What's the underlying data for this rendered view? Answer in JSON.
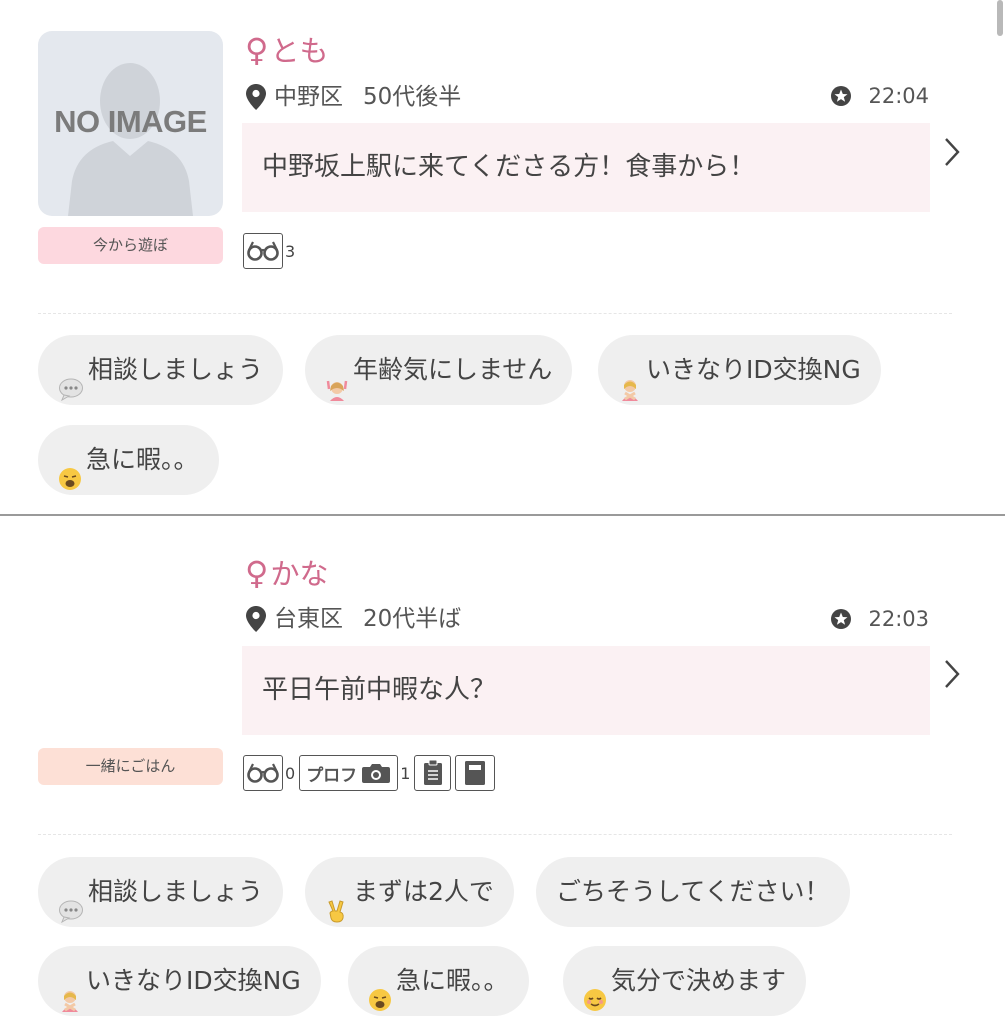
{
  "posts": [
    {
      "name": "とも",
      "area": "中野区",
      "age": "50代後半",
      "time": "22:04",
      "message": "中野坂上駅に来てくださる方！食事から！",
      "avatar_text": "NO IMAGE",
      "tag": "今から遊ぼ",
      "views": "3",
      "chips": [
        {
          "icon": "speech-bubble-icon",
          "label": "相談しましょう"
        },
        {
          "icon": "person-ok-icon",
          "label": "年齢気にしません"
        },
        {
          "icon": "person-no-icon",
          "label": "いきなりID交換NG"
        },
        {
          "icon": "weary-face-icon",
          "label": "急に暇。。"
        }
      ]
    },
    {
      "name": "かな",
      "area": "台東区",
      "age": "20代半ば",
      "time": "22:03",
      "message": "平日午前中暇な人？",
      "tag": "一緒にごはん",
      "views": "0",
      "profile_label": "プロフ",
      "photo_count": "1",
      "chips": [
        {
          "icon": "speech-bubble-icon",
          "label": "相談しましょう"
        },
        {
          "icon": "victory-hand-icon",
          "label": "まずは2人で"
        },
        {
          "icon": "",
          "label": "ごちそうしてください！"
        },
        {
          "icon": "person-no-icon",
          "label": "いきなりID交換NG"
        },
        {
          "icon": "weary-face-icon",
          "label": "急に暇。。"
        },
        {
          "icon": "relieved-face-icon",
          "label": "気分で決めます"
        }
      ]
    }
  ],
  "colors": {
    "name_pink": "#d06a8c",
    "message_bg": "#fbf1f3",
    "tag_pink": "#fdd8df",
    "tag_peach": "#fde0d6",
    "chip_bg": "#efefef"
  }
}
